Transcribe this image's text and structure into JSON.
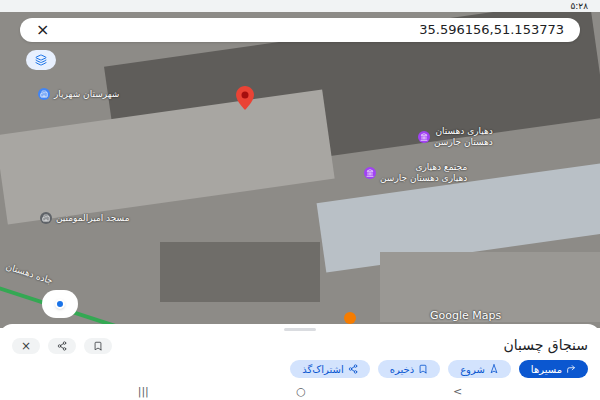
{
  "status_bar": {
    "time": "۵:۲۸"
  },
  "search": {
    "close": "×",
    "query": "35.596156,51.153773"
  },
  "map": {
    "labels": [
      {
        "lines": [
          "شهرستان شهریار"
        ],
        "color": "#4285f4"
      },
      {
        "lines": [
          "دهیاری دهستان",
          "دهستان جارسن"
        ],
        "color": "#a142f4"
      },
      {
        "lines": [
          "مجتمع دهیاری",
          "دهیاری دهستان جارسن"
        ],
        "color": "#a142f4"
      },
      {
        "lines": [
          "مسجد امیرالمومنین"
        ],
        "color": "#5f6368"
      }
    ],
    "road": "جاده دهستان",
    "watermark": "Google Maps"
  },
  "sheet": {
    "title": "سنجاق چسبان",
    "close": "×",
    "actions": [
      {
        "label": "مسیرها",
        "selected": true
      },
      {
        "label": "شروع",
        "selected": false
      },
      {
        "label": "ذخیره",
        "selected": false
      },
      {
        "label": "اشتراک‌گذ",
        "selected": false
      }
    ]
  },
  "nav_bar": {
    "buttons": [
      "|||",
      "○",
      "<"
    ]
  }
}
